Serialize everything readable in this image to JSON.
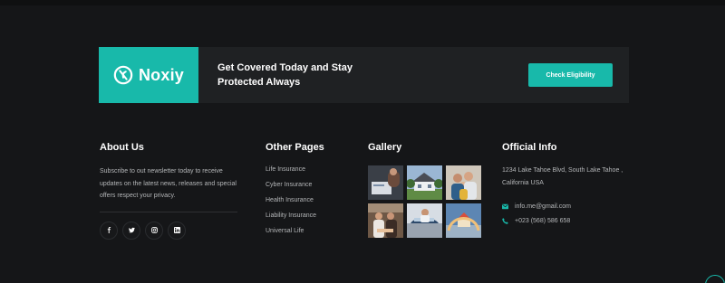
{
  "cta": {
    "logo_text": "Noxiy",
    "headline": "Get Covered Today and Stay Protected Always",
    "button_label": "Check Eligibility"
  },
  "about": {
    "title": "About Us",
    "text": "Subscribe to out newsletter today to receive updates on the latest news, releases and special offers respect your privacy.",
    "socials": [
      "facebook-icon",
      "twitter-icon",
      "instagram-icon",
      "linkedin-icon"
    ]
  },
  "pages": {
    "title": "Other Pages",
    "links": [
      "Life Insurance",
      "Cyber Insurance",
      "Health Insurance",
      "Liability Insurance",
      "Universal Life"
    ]
  },
  "gallery": {
    "title": "Gallery",
    "images": [
      "gallery-image-1",
      "gallery-image-2",
      "gallery-image-3",
      "gallery-image-4",
      "gallery-image-5",
      "gallery-image-6"
    ]
  },
  "info": {
    "title": "Official Info",
    "address": "1234 Lake Tahoe Blvd, South Lake Tahoe , California USA",
    "email": "info.me@gmail.com",
    "phone": "+023 (568) 586 658"
  },
  "colors": {
    "accent": "#18b9aa",
    "background": "#151618",
    "panel": "#1f2123",
    "muted_text": "#b4b6b8"
  }
}
